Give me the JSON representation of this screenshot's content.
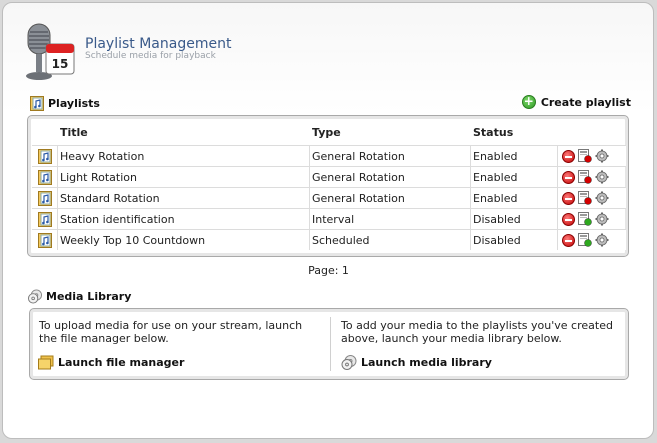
{
  "header": {
    "title": "Playlist Management",
    "subtitle": "Schedule media for playback",
    "calendar_day": "15"
  },
  "playlists_section": {
    "title": "Playlists",
    "create_label": "Create playlist"
  },
  "table": {
    "columns": [
      "Title",
      "Type",
      "Status"
    ],
    "rows": [
      {
        "title": "Heavy Rotation",
        "type": "General Rotation",
        "status": "Enabled",
        "schedule_badge": "red"
      },
      {
        "title": "Light Rotation",
        "type": "General Rotation",
        "status": "Enabled",
        "schedule_badge": "red"
      },
      {
        "title": "Standard Rotation",
        "type": "General Rotation",
        "status": "Enabled",
        "schedule_badge": "red"
      },
      {
        "title": "Station identification",
        "type": "Interval",
        "status": "Disabled",
        "schedule_badge": "green"
      },
      {
        "title": "Weekly Top 10 Countdown",
        "type": "Scheduled",
        "status": "Disabled",
        "schedule_badge": "green"
      }
    ]
  },
  "pager": {
    "label": "Page: 1"
  },
  "media_library": {
    "title": "Media Library",
    "left_text": "To upload media for use on your stream, launch the file manager below.",
    "left_link": "Launch file manager",
    "right_text": "To add your media to the playlists you've created above, launch your media library below.",
    "right_link": "Launch media library"
  },
  "colors": {
    "title_blue": "#3a5a8a",
    "badge_red": "#d40000",
    "badge_green": "#2ea81f",
    "delete_red": "#c10000",
    "add_green": "#2e9a24"
  }
}
